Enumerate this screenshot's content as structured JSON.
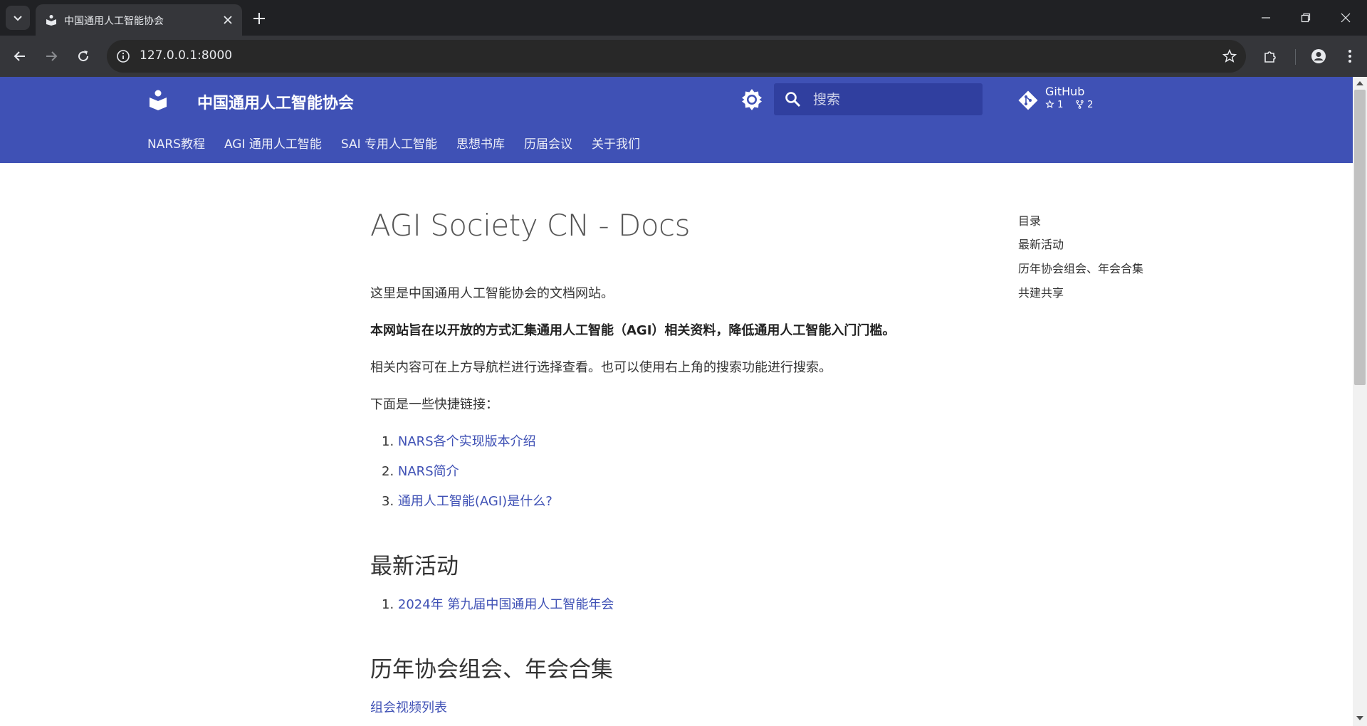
{
  "browser": {
    "tab_title": "中国通用人工智能协会",
    "url": "127.0.0.1:8000"
  },
  "colors": {
    "header_bg": "#3f51b5",
    "search_bg": "#303f9f",
    "link": "#3f51b5"
  },
  "header": {
    "site_title": "中国通用人工智能协会",
    "search_placeholder": "搜索",
    "repo": {
      "name": "GitHub",
      "stars": "1",
      "forks": "2"
    },
    "nav": [
      "NARS教程",
      "AGI 通用人工智能",
      "SAI 专用人工智能",
      "思想书库",
      "历届会议",
      "关于我们"
    ]
  },
  "content": {
    "title": "AGI Society CN - Docs",
    "intro": "这里是中国通用人工智能协会的文档网站。",
    "mission": "本网站旨在以开放的方式汇集通用人工智能（AGI）相关资料，降低通用人工智能入门门槛。",
    "hint": "相关内容可在上方导航栏进行选择查看。也可以使用右上角的搜索功能进行搜索。",
    "quick_links_intro": "下面是一些快捷链接：",
    "quick_links": [
      "NARS各个实现版本介绍",
      "NARS简介",
      "通用人工智能(AGI)是什么?"
    ],
    "latest_heading": "最新活动",
    "latest_items": [
      "2024年 第九届中国通用人工智能年会"
    ],
    "history_heading": "历年协会组会、年会合集",
    "history_link": "组会视频列表"
  },
  "toc": {
    "title": "目录",
    "items": [
      "最新活动",
      "历年协会组会、年会合集",
      "共建共享"
    ]
  },
  "icons": {
    "tab_search": "chevron-down-icon",
    "favicon": "book-icon",
    "theme": "brightness-icon",
    "search": "magnify-icon",
    "repo": "git-icon"
  }
}
